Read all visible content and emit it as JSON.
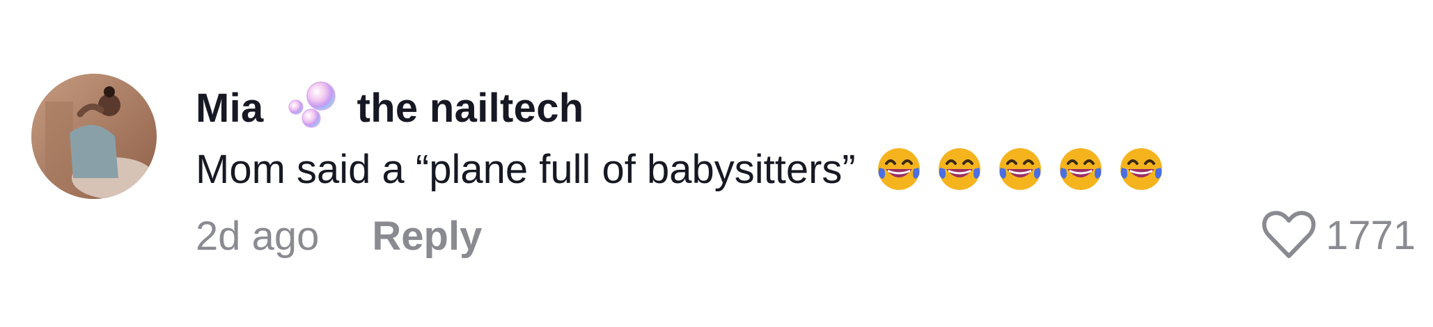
{
  "comment": {
    "username_first": "Mia",
    "username_last": "the nailtech",
    "username_emoji": "bubbles-icon",
    "text": "Mom said a “plane full of babysitters”",
    "emojis": [
      "laughing-tears-icon",
      "laughing-tears-icon",
      "laughing-tears-icon",
      "laughing-tears-icon",
      "laughing-tears-icon"
    ],
    "timestamp": "2d ago",
    "reply_label": "Reply",
    "like_icon": "heart-outline-icon",
    "like_count": "1771"
  },
  "colors": {
    "text_primary": "#161823",
    "text_secondary": "#8a8b91",
    "emoji_face": "#f5b41e",
    "emoji_tears": "#4a6fe3",
    "emoji_mouth": "#9b2f63"
  }
}
